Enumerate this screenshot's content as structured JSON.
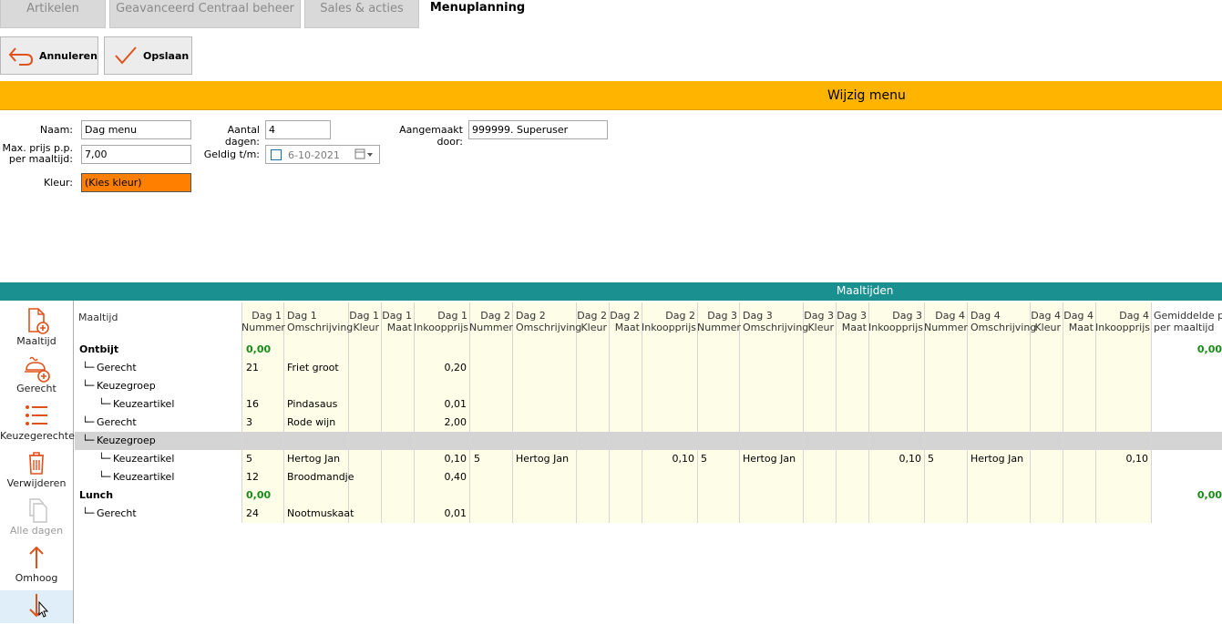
{
  "tabs": [
    {
      "label": "Artikelen",
      "active": false
    },
    {
      "label": "Geavanceerd Centraal beheer",
      "active": false
    },
    {
      "label": "Sales & acties",
      "active": false
    },
    {
      "label": "Menuplanning",
      "active": true
    }
  ],
  "toolbar": {
    "cancel_label": "Annuleren",
    "save_label": "Opslaan"
  },
  "header": {
    "title": "Wijzig menu"
  },
  "form": {
    "naam_label": "Naam:",
    "naam_value": "Dag menu",
    "aantal_label": "Aantal dagen:",
    "aantal_value": "4",
    "aangemaakt_label": "Aangemaakt door:",
    "aangemaakt_value": "999999. Superuser",
    "maxprijs_label_1": "Max. prijs p.p.",
    "maxprijs_label_2": "per maaltijd:",
    "maxprijs_value": "7,00",
    "geldig_label": "Geldig t/m:",
    "geldig_value": "6-10-2021",
    "kleur_label": "Kleur:",
    "kleur_value": "(Kies kleur)",
    "kleur_color": "#ff8000"
  },
  "maaltijden": {
    "title": "Maaltijden"
  },
  "side_buttons": [
    {
      "label": "Maaltijd",
      "icon": "document-add-icon",
      "enabled": true
    },
    {
      "label": "Gerecht",
      "icon": "dish-add-icon",
      "enabled": true
    },
    {
      "label": "Keuzegerechten",
      "icon": "list-icon",
      "enabled": true
    },
    {
      "label": "Verwijderen",
      "icon": "trash-icon",
      "enabled": true
    },
    {
      "label": "Alle dagen",
      "icon": "copy-icon",
      "enabled": false
    },
    {
      "label": "Omhoog",
      "icon": "arrow-up-icon",
      "enabled": true
    },
    {
      "label": "",
      "icon": "arrow-down-icon",
      "enabled": true
    }
  ],
  "grid": {
    "headers": [
      {
        "l1": "Maaltijd",
        "l2": ""
      },
      {
        "l1": "Dag 1",
        "l2": "Nummer"
      },
      {
        "l1": "Dag 1",
        "l2": "Omschrijving"
      },
      {
        "l1": "Dag 1",
        "l2": "Kleur"
      },
      {
        "l1": "Dag 1",
        "l2": "Maat"
      },
      {
        "l1": "Dag 1",
        "l2": "Inkoopprijs"
      },
      {
        "l1": "Dag 2",
        "l2": "Nummer"
      },
      {
        "l1": "Dag 2",
        "l2": "Omschrijving"
      },
      {
        "l1": "Dag 2",
        "l2": "Kleur"
      },
      {
        "l1": "Dag 2",
        "l2": "Maat"
      },
      {
        "l1": "Dag 2",
        "l2": "Inkoopprijs"
      },
      {
        "l1": "Dag 3",
        "l2": "Nummer"
      },
      {
        "l1": "Dag 3",
        "l2": "Omschrijving"
      },
      {
        "l1": "Dag 3",
        "l2": "Kleur"
      },
      {
        "l1": "Dag 3",
        "l2": "Maat"
      },
      {
        "l1": "Dag 3",
        "l2": "Inkoopprijs"
      },
      {
        "l1": "Dag 4",
        "l2": "Nummer"
      },
      {
        "l1": "Dag 4",
        "l2": "Omschrijving"
      },
      {
        "l1": "Dag 4",
        "l2": "Kleur"
      },
      {
        "l1": "Dag 4",
        "l2": "Maat"
      },
      {
        "l1": "Dag 4",
        "l2": "Inkoopprijs"
      },
      {
        "l1": "Gemiddelde prijs",
        "l2": "per maaltijd"
      }
    ],
    "rows": [
      {
        "type": "meal",
        "label": "Ontbijt",
        "prefix": "",
        "d1_nummer": "0,00",
        "avg": "0,00"
      },
      {
        "type": "item",
        "label": "Gerecht",
        "prefix": "└─",
        "d1_nummer": "21",
        "d1_omschr": "Friet groot",
        "d1_prijs": "0,20"
      },
      {
        "type": "item",
        "label": "Keuzegroep",
        "prefix": "└─"
      },
      {
        "type": "sub",
        "label": "Keuzeartikel",
        "prefix": "└─",
        "d1_nummer": "16",
        "d1_omschr": "Pindasaus",
        "d1_prijs": "0,01"
      },
      {
        "type": "item",
        "label": "Gerecht",
        "prefix": "└─",
        "d1_nummer": "3",
        "d1_omschr": "Rode wijn",
        "d1_prijs": "2,00"
      },
      {
        "type": "item",
        "label": "Keuzegroep",
        "prefix": "└─",
        "selected": true
      },
      {
        "type": "sub",
        "label": "Keuzeartikel",
        "prefix": "└─",
        "d1_nummer": "5",
        "d1_omschr": "Hertog Jan",
        "d1_prijs": "0,10",
        "d2_nummer": "5",
        "d2_omschr": "Hertog Jan",
        "d2_prijs": "0,10",
        "d3_nummer": "5",
        "d3_omschr": "Hertog Jan",
        "d3_prijs": "0,10",
        "d4_nummer": "5",
        "d4_omschr": "Hertog Jan",
        "d4_prijs": "0,10"
      },
      {
        "type": "sub",
        "label": "Keuzeartikel",
        "prefix": "└─",
        "d1_nummer": "12",
        "d1_omschr": "Broodmandje",
        "d1_prijs": "0,40"
      },
      {
        "type": "meal",
        "label": "Lunch",
        "prefix": "",
        "d1_nummer": "0,00",
        "avg": "0,00"
      },
      {
        "type": "item",
        "label": "Gerecht",
        "prefix": "└─",
        "d1_nummer": "24",
        "d1_omschr": "Nootmuskaat",
        "d1_prijs": "0,01"
      }
    ]
  },
  "colors": {
    "band": "#ffb500",
    "teal": "#1b9090",
    "accent_icon": "#e0521b",
    "cell_yellow": "#fdfde8",
    "green_total": "#1a8a1a"
  }
}
